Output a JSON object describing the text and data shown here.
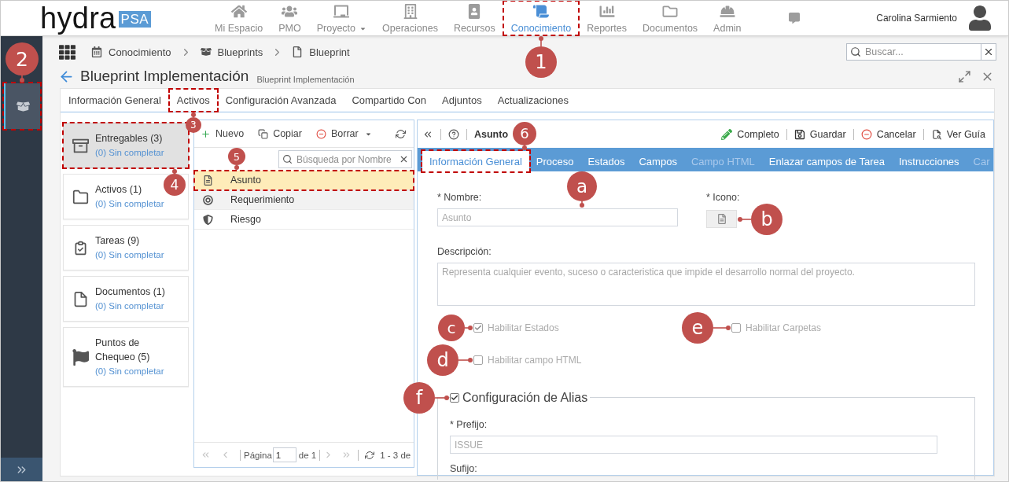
{
  "top_bar": {
    "logo": "hydra",
    "logo_badge": "PSA",
    "nav": [
      {
        "label": "Mi Espacio",
        "selected": false,
        "dropdown": false,
        "highlighted": false
      },
      {
        "label": "PMO",
        "selected": false,
        "dropdown": false,
        "highlighted": false
      },
      {
        "label": "Proyecto",
        "selected": false,
        "dropdown": true,
        "highlighted": false
      },
      {
        "label": "Operaciones",
        "selected": false,
        "dropdown": false,
        "highlighted": false
      },
      {
        "label": "Recursos",
        "selected": false,
        "dropdown": false,
        "highlighted": false
      },
      {
        "label": "Conocimiento",
        "selected": true,
        "dropdown": false,
        "highlighted": true,
        "callout": "1"
      },
      {
        "label": "Reportes",
        "selected": false,
        "dropdown": false,
        "highlighted": false
      },
      {
        "label": "Documentos",
        "selected": false,
        "dropdown": false,
        "highlighted": false
      },
      {
        "label": "Admin",
        "selected": false,
        "dropdown": false,
        "highlighted": false
      }
    ],
    "user": "Carolina Sarmiento"
  },
  "sidebar": {
    "items": [
      {
        "selected": true,
        "highlighted": true,
        "callout": "2"
      }
    ]
  },
  "breadcrumb": [
    {
      "label": "Conocimiento"
    },
    {
      "label": "Blueprints"
    },
    {
      "label": "Blueprint"
    }
  ],
  "search": {
    "placeholder": "Buscar..."
  },
  "page": {
    "title": "Blueprint Implementación",
    "subtitle": "Blueprint Implementación"
  },
  "tabs": [
    {
      "label": "Información General",
      "highlighted": false
    },
    {
      "label": "Activos",
      "highlighted": true,
      "callout": "3"
    },
    {
      "label": "Configuración Avanzada",
      "highlighted": false
    },
    {
      "label": "Compartido Con",
      "highlighted": false
    },
    {
      "label": "Adjuntos",
      "highlighted": false
    },
    {
      "label": "Actualizaciones",
      "highlighted": false
    }
  ],
  "asset_types": [
    {
      "title": "Entregables (3)",
      "status": "(0) Sin completar",
      "selected": true,
      "highlighted": true,
      "callout": "4"
    },
    {
      "title": "Activos (1)",
      "status": "(0) Sin completar",
      "selected": false,
      "highlighted": false
    },
    {
      "title": "Tareas (9)",
      "status": "(0) Sin completar",
      "selected": false,
      "highlighted": false
    },
    {
      "title": "Documentos (1)",
      "status": "(0) Sin completar",
      "selected": false,
      "highlighted": false
    },
    {
      "title": "Puntos de Chequeo (5)",
      "status": "(0) Sin completar",
      "selected": false,
      "highlighted": false
    }
  ],
  "items_panel": {
    "toolbar": [
      {
        "label": "Nuevo",
        "dropdown": false
      },
      {
        "label": "Copiar",
        "dropdown": false
      },
      {
        "label": "Borrar",
        "dropdown": true
      }
    ],
    "search": {
      "placeholder": "Búsqueda por Nombre"
    },
    "rows": [
      {
        "name": "Asunto",
        "selected": true,
        "highlighted": true,
        "callout": "5"
      },
      {
        "name": "Requerimiento",
        "selected": false,
        "highlighted": false
      },
      {
        "name": "Riesgo",
        "selected": false,
        "highlighted": false
      }
    ],
    "pager": {
      "arrows_disabled": true,
      "page_label": "Página",
      "page": "1",
      "page_count": "de 1",
      "summary": "1 - 3 de"
    }
  },
  "detail_panel": {
    "title": "Asunto",
    "actions": [
      {
        "label": "Completo"
      },
      {
        "label": "Guardar"
      },
      {
        "label": "Cancelar"
      },
      {
        "label": "Ver Guía"
      }
    ],
    "tabs": [
      {
        "label": "Información General",
        "selected": true,
        "disabled": false,
        "highlighted": true,
        "callout": "6"
      },
      {
        "label": "Proceso",
        "selected": false,
        "disabled": false,
        "highlighted": false
      },
      {
        "label": "Estados",
        "selected": false,
        "disabled": false,
        "highlighted": false
      },
      {
        "label": "Campos",
        "selected": false,
        "disabled": false,
        "highlighted": false
      },
      {
        "label": "Campo HTML",
        "selected": false,
        "disabled": true,
        "highlighted": false
      },
      {
        "label": "Enlazar campos de Tarea",
        "selected": false,
        "disabled": false,
        "highlighted": false
      },
      {
        "label": "Instrucciones",
        "selected": false,
        "disabled": false,
        "highlighted": false
      },
      {
        "label": "Car",
        "selected": false,
        "disabled": true,
        "highlighted": false
      }
    ],
    "form": {
      "disabled": true,
      "name": {
        "label": "* Nombre:",
        "value": "Asunto",
        "callout": "a"
      },
      "icon": {
        "label": "* Icono:",
        "callout": "b"
      },
      "description": {
        "label": "Descripción:",
        "value": "Representa cualquier evento, suceso o caracteristica que impide el desarrollo normal del proyecto."
      },
      "options": [
        {
          "label": "Habilitar Estados",
          "checked": true,
          "callout": "c"
        },
        {
          "label": "Habilitar Carpetas",
          "checked": false,
          "callout": "e"
        },
        {
          "label": "Habilitar campo HTML",
          "checked": false,
          "callout": "d"
        }
      ],
      "alias": {
        "label": "Configuración de Alias",
        "checked": true,
        "callout": "f",
        "prefix": {
          "label": "* Prefijo:",
          "value": "ISSUE"
        },
        "suffix": {
          "label": "Sufijo:"
        }
      }
    }
  }
}
